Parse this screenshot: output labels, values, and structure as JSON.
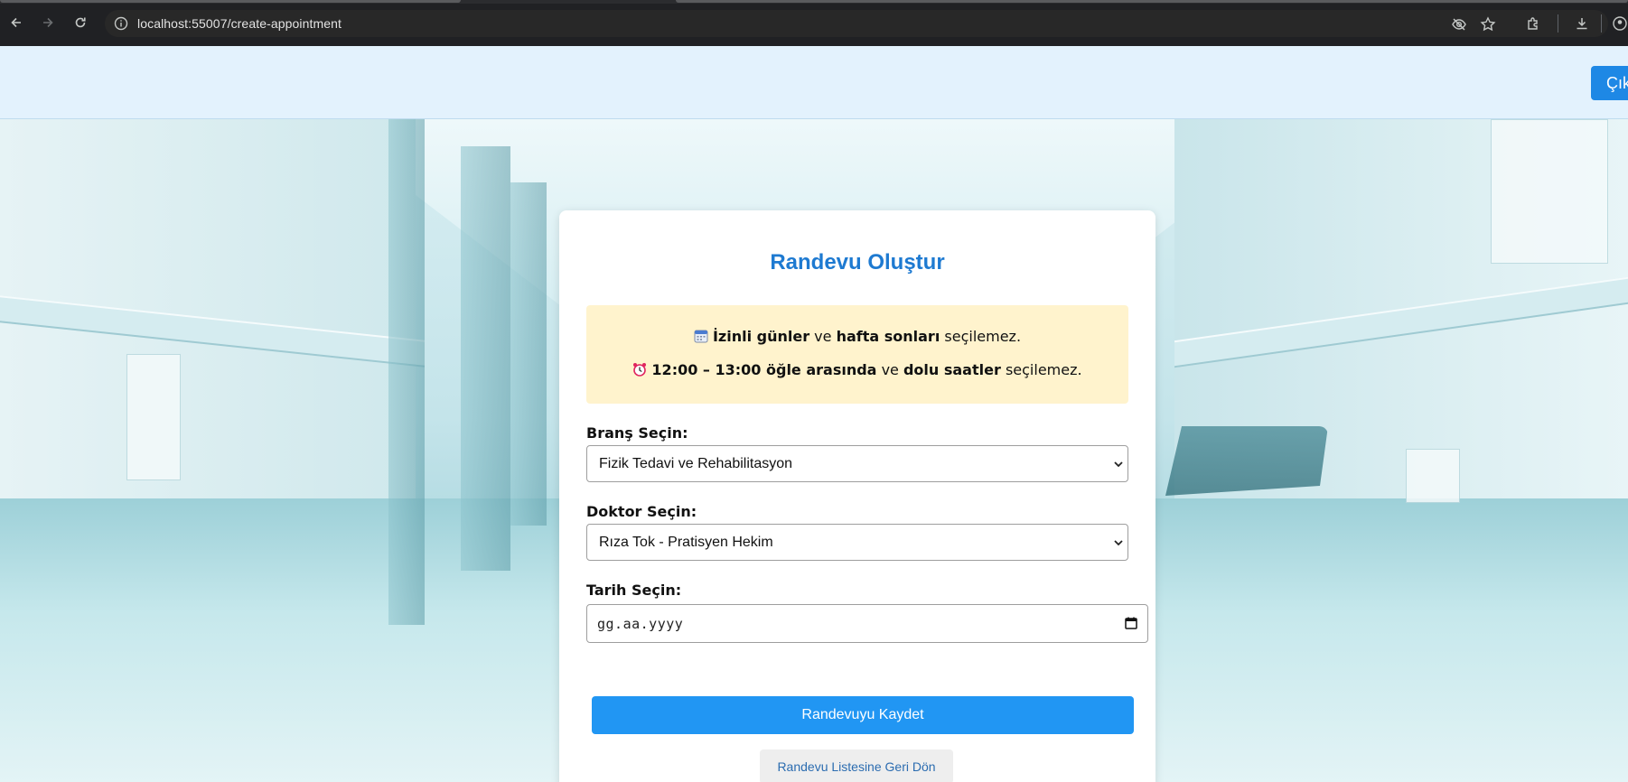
{
  "browser": {
    "url": "localhost:55007/create-appointment",
    "icons": [
      "back-arrow-icon",
      "forward-arrow-icon",
      "reload-icon",
      "site-info-icon",
      "eye-off-icon",
      "star-icon",
      "extensions-icon",
      "download-icon",
      "profile-icon"
    ]
  },
  "header": {
    "logout_label": "Çık"
  },
  "form": {
    "title": "Randevu Oluştur",
    "notice": {
      "line1_bold1": "İzinli günler",
      "line1_text1": " ve ",
      "line1_bold2": "hafta sonları",
      "line1_text2": " seçilemez.",
      "line2_bold1": "12:00 – 13:00 öğle arasında",
      "line2_text1": " ve ",
      "line2_bold2": "dolu saatler",
      "line2_text2": " seçilemez."
    },
    "branch_label": "Branş Seçin:",
    "branch_value": "Fizik Tedavi ve Rehabilitasyon",
    "doctor_label": "Doktor Seçin:",
    "doctor_value": "Rıza Tok - Pratisyen Hekim",
    "date_label": "Tarih Seçin:",
    "date_placeholder": "gg.aa.yyyy",
    "save_label": "Randevuyu Kaydet",
    "back_label": "Randevu Listesine Geri Dön"
  },
  "colors": {
    "accent": "#2196f3",
    "title": "#1e7ad1",
    "notice_bg": "#fff3cd",
    "topbar_bg": "#e3f2fd"
  }
}
